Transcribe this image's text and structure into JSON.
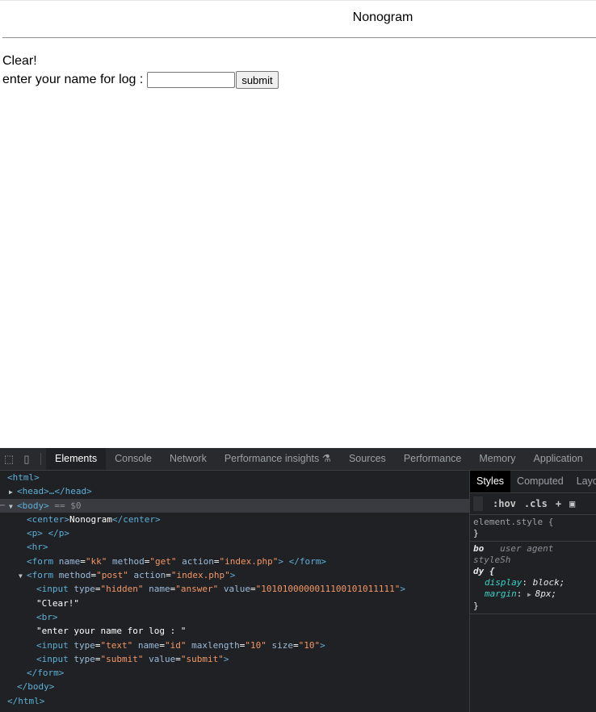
{
  "page": {
    "title": "Nonogram",
    "clear_text": "Clear!",
    "log_label": "enter your name for log :",
    "name_input_value": "",
    "submit_label": "submit"
  },
  "devtools": {
    "tabs": [
      "Elements",
      "Console",
      "Network",
      "Performance insights",
      "Sources",
      "Performance",
      "Memory",
      "Application"
    ],
    "active_tab": "Elements",
    "dom": {
      "html_open": "<html>",
      "head": "<head>…</head>",
      "body_open": "<body>",
      "body_marker": "== $0",
      "center_open": "<center>",
      "center_text": "Nonogram",
      "center_close": "</center>",
      "p_line": "<p> </p>",
      "hr_line": "<hr>",
      "form1_tag": "<form",
      "form1_name_attr": "name",
      "form1_name_val": "\"kk\"",
      "form1_method_attr": "method",
      "form1_method_val": "\"get\"",
      "form1_action_attr": "action",
      "form1_action_val": "\"index.php\"",
      "form1_end": "> </form>",
      "form2_tag": "<form",
      "form2_method_attr": "method",
      "form2_method_val": "\"post\"",
      "form2_action_attr": "action",
      "form2_action_val": "\"index.php\"",
      "input_tag": "<input",
      "type_attr": "type",
      "name_attr": "name",
      "value_attr": "value",
      "hidden_val": "\"hidden\"",
      "answer_name_val": "\"answer\"",
      "answer_value_val": "\"1010100000011100101011111\"",
      "clear_text_node": "\"Clear!\"",
      "br_line": "<br>",
      "log_text_node": "\"enter your name for log : \"",
      "text_val": "\"text\"",
      "id_val": "\"id\"",
      "maxlength_attr": "maxlength",
      "maxlength_val": "\"10\"",
      "size_attr": "size",
      "size_val": "\"10\"",
      "submit_type_val": "\"submit\"",
      "submit_value_val": "\"submit\"",
      "close_gt": ">",
      "form_close": "</form>",
      "body_close": "</body>",
      "html_close": "</html>"
    },
    "styles": {
      "tabs": [
        "Styles",
        "Computed",
        "Layo"
      ],
      "filter_hov": ":hov",
      "filter_cls": ".cls",
      "plus": "+",
      "element_style": "element.style {",
      "close_brace": "}",
      "selector_part1": "bo",
      "selector_part2": "dy {",
      "ua_label": "user agent styleSh",
      "prop1_name": "display",
      "prop1_value": "block;",
      "prop2_name": "margin",
      "prop2_value": "8px;"
    }
  }
}
